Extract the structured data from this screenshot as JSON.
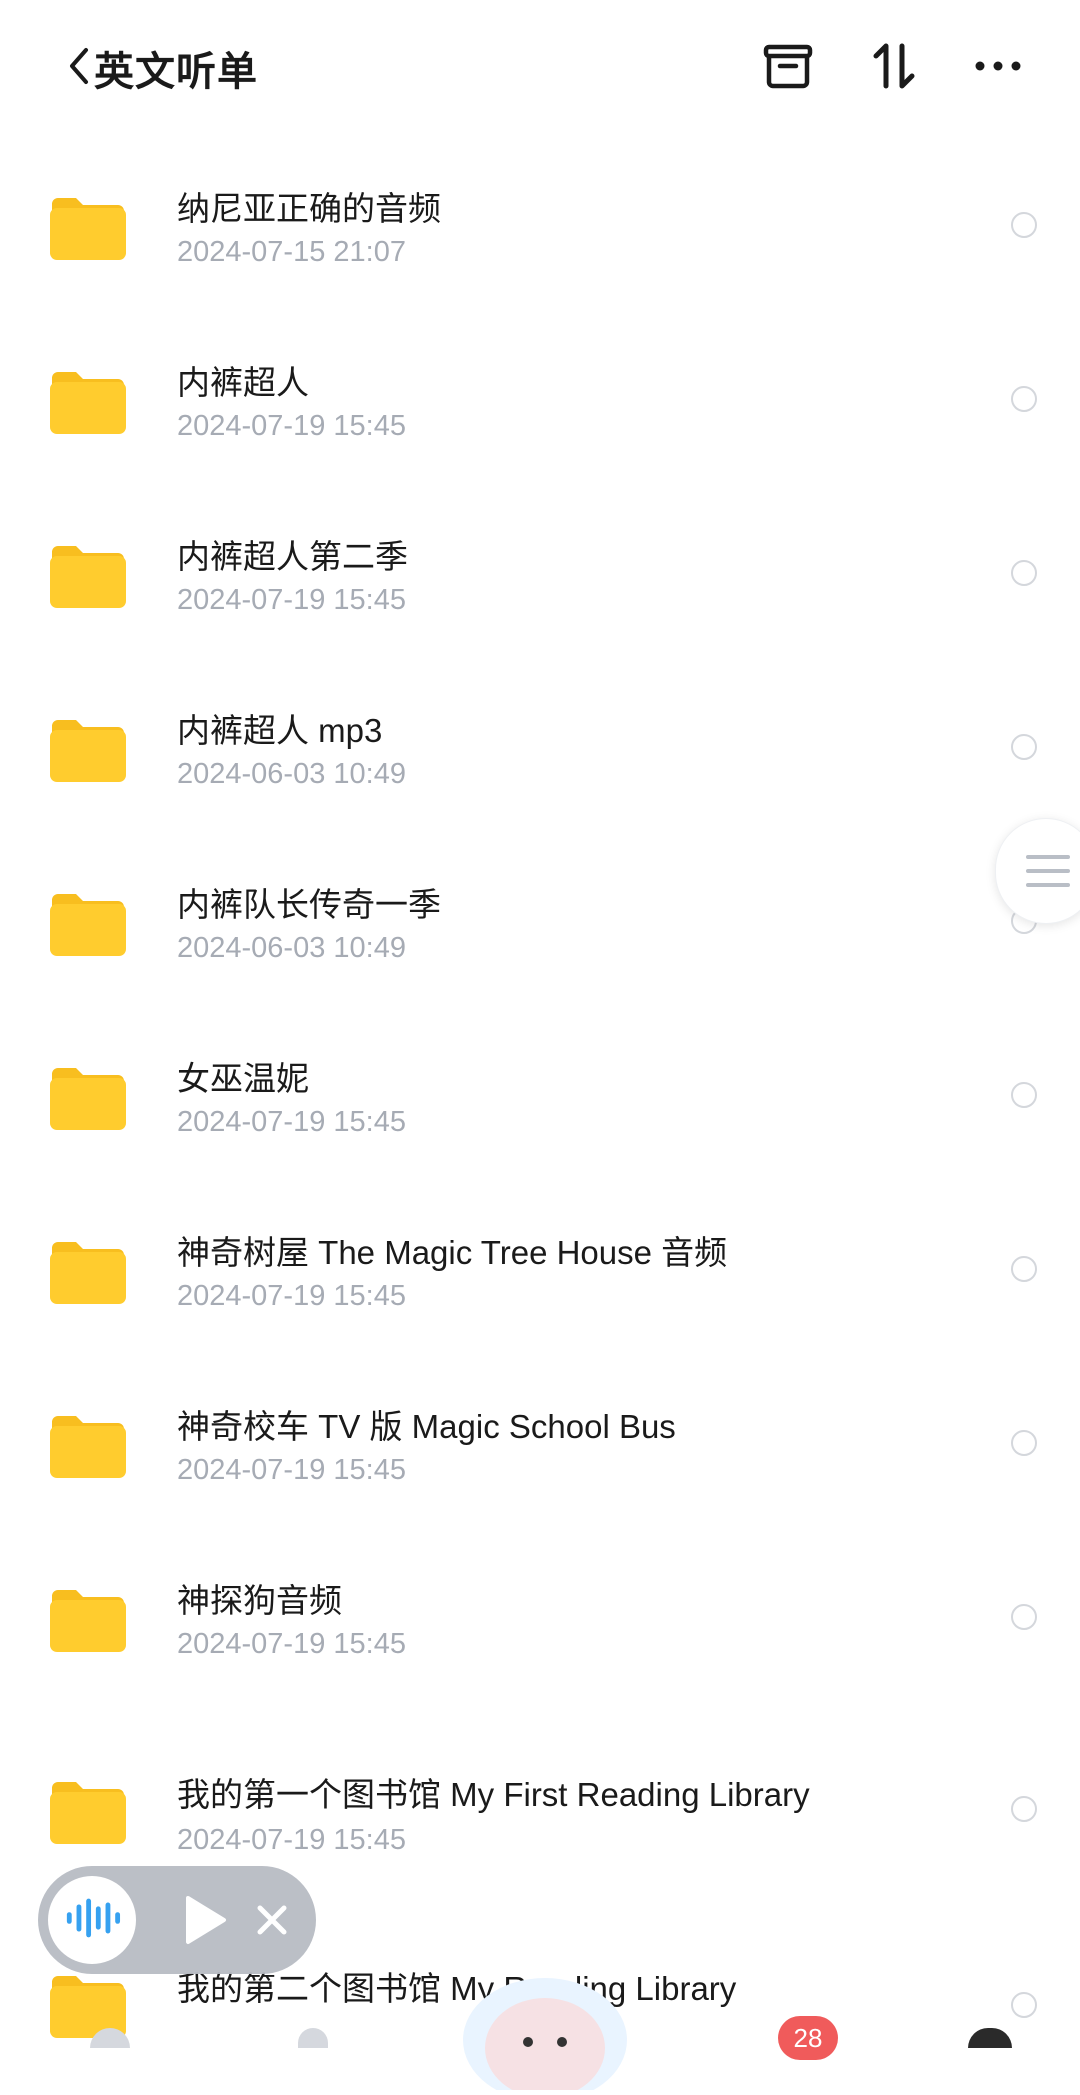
{
  "header": {
    "title": "英文听单",
    "icons": [
      "back-chevron-icon",
      "archive-box-icon",
      "sort-icon",
      "more-icon"
    ]
  },
  "items": [
    {
      "name": "纳尼亚正确的音频",
      "date": "2024-07-15 21:07"
    },
    {
      "name": "内裤超人",
      "date": "2024-07-19 15:45"
    },
    {
      "name": "内裤超人第二季",
      "date": "2024-07-19 15:45"
    },
    {
      "name": "内裤超人 mp3",
      "date": "2024-06-03 10:49"
    },
    {
      "name": "内裤队长传奇一季",
      "date": "2024-06-03 10:49"
    },
    {
      "name": "女巫温妮",
      "date": "2024-07-19 15:45"
    },
    {
      "name": "神奇树屋 The Magic Tree House 音频",
      "date": "2024-07-19 15:45"
    },
    {
      "name": "神奇校车 TV 版 Magic School Bus",
      "date": "2024-07-19 15:45"
    },
    {
      "name": "神探狗音频",
      "date": "2024-07-19 15:45"
    },
    {
      "name": "我的第一个图书馆 My First Reading Library",
      "date": "2024-07-19 15:45"
    },
    {
      "name": "我的第二个图书馆 My Reading Library",
      "date": ""
    }
  ],
  "player": {
    "icons": [
      "sound-wave-icon",
      "play-icon",
      "close-icon"
    ]
  },
  "bottom": {
    "badge_count": "28"
  },
  "colors": {
    "folder": "#FFCC2E",
    "folder_tab": "#F8BE1F",
    "text_primary": "#1A1A1A",
    "text_secondary": "#A6ABB4",
    "accent_blue": "#2C9DF0",
    "badge_red": "#F05B5B"
  }
}
